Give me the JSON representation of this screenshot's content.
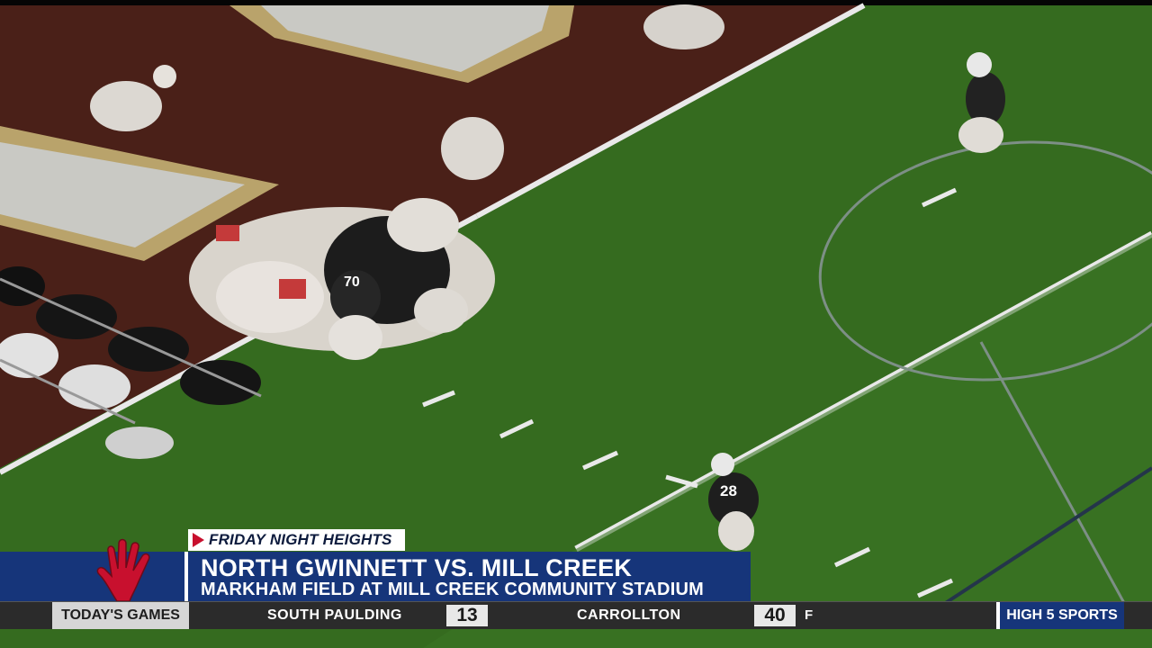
{
  "show_tag": {
    "label": "FRIDAY NIGHT HEIGHTS"
  },
  "headline": {
    "title": "NORTH GWINNETT VS. MILL CREEK",
    "subtitle": "MARKHAM FIELD AT MILL CREEK COMMUNITY STADIUM"
  },
  "ticker": {
    "label": "TODAY'S GAMES",
    "games": [
      {
        "team": "SOUTH  PAULDING",
        "score": "13"
      },
      {
        "team": "CARROLLTON",
        "score": "40",
        "status": "F"
      }
    ],
    "brand": "HIGH 5 SPORTS"
  },
  "colors": {
    "brand_blue": "#16357a",
    "accent_red": "#c8102e",
    "field_green": "#356b1f",
    "endzone": "#4a2018"
  },
  "icons": [
    "play-icon",
    "hand-logo-icon"
  ]
}
